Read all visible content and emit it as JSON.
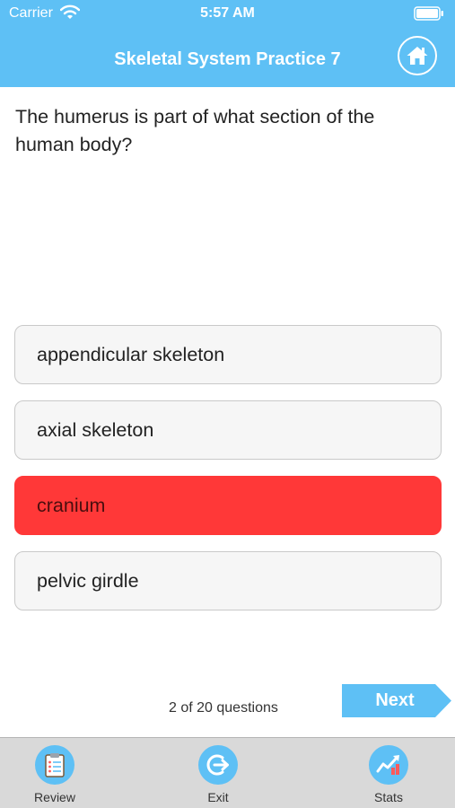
{
  "status_bar": {
    "carrier": "Carrier",
    "time": "5:57 AM"
  },
  "header": {
    "title": "Skeletal System Practice 7"
  },
  "question": {
    "text": "The humerus is part of what section of the human body?"
  },
  "answers": [
    {
      "label": "appendicular skeleton",
      "state": "default"
    },
    {
      "label": "axial skeleton",
      "state": "default"
    },
    {
      "label": "cranium",
      "state": "incorrect"
    },
    {
      "label": "pelvic girdle",
      "state": "default"
    }
  ],
  "progress": {
    "text": "2 of 20 questions",
    "current": 2,
    "total": 20
  },
  "next_button": {
    "label": "Next"
  },
  "tabs": [
    {
      "label": "Review",
      "icon": "clipboard-icon"
    },
    {
      "label": "Exit",
      "icon": "exit-icon"
    },
    {
      "label": "Stats",
      "icon": "chart-icon"
    }
  ],
  "colors": {
    "accent": "#5ec0f5",
    "incorrect": "#ff3838",
    "tab_bar": "#d9d9d9"
  }
}
